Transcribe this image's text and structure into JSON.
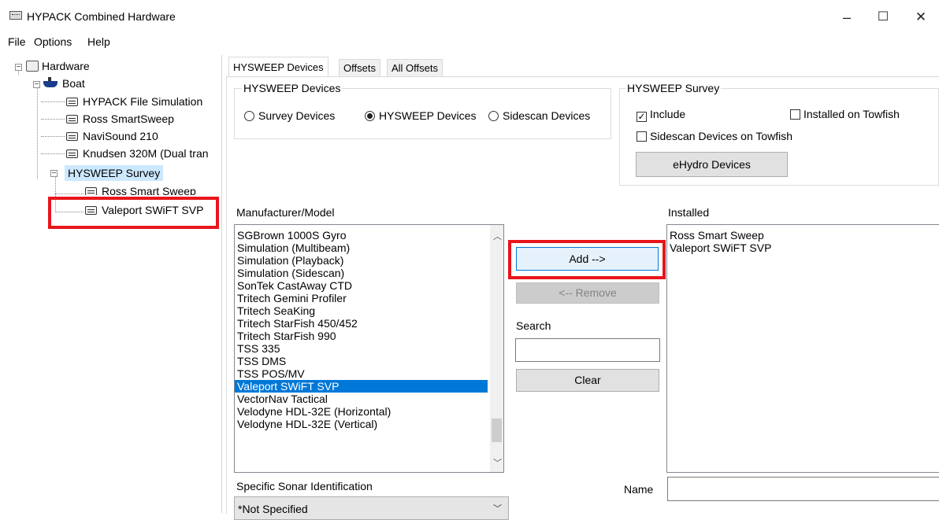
{
  "window": {
    "title": "HYPACK Combined Hardware",
    "minimize": "–",
    "maximize": "☐",
    "close": "✕"
  },
  "menu": [
    "File",
    "Options",
    "Help"
  ],
  "tree": {
    "root": "Hardware",
    "boat": "Boat",
    "boat_items": [
      "HYPACK File Simulation",
      "Ross SmartSweep",
      "NaviSound 210",
      "Knudsen 320M (Dual tran"
    ],
    "hysweep": "HYSWEEP Survey",
    "hysweep_items": [
      "Ross Smart Sweep",
      "Valeport SWiFT SVP"
    ]
  },
  "tabs": [
    "HYSWEEP Devices",
    "Offsets",
    "All Offsets"
  ],
  "devices_group": {
    "legend": "HYSWEEP Devices",
    "radios": [
      "Survey Devices",
      "HYSWEEP Devices",
      "Sidescan Devices"
    ],
    "selected": "HYSWEEP Devices"
  },
  "survey_group": {
    "legend": "HYSWEEP Survey",
    "include": "Include",
    "include_checked": true,
    "installed_towfish": "Installed on Towfish",
    "sidescan_towfish": "Sidescan Devices on Towfish",
    "ehydro": "eHydro Devices"
  },
  "manufacturer": {
    "label": "Manufacturer/Model",
    "items": [
      "SGBrown 1000S Gyro",
      "Simulation (Multibeam)",
      "Simulation (Playback)",
      "Simulation (Sidescan)",
      "SonTek CastAway CTD",
      "Tritech Gemini Profiler",
      "Tritech SeaKing",
      "Tritech StarFish 450/452",
      "Tritech StarFish 990",
      "TSS 335",
      "TSS DMS",
      "TSS POS/MV",
      "Valeport SWiFT SVP",
      "VectorNav Tactical",
      "Velodyne HDL-32E (Horizontal)",
      "Velodyne HDL-32E (Vertical)"
    ],
    "selected_index": 12
  },
  "buttons": {
    "add": "Add -->",
    "remove": "<-- Remove",
    "clear": "Clear"
  },
  "search": {
    "label": "Search",
    "value": ""
  },
  "installed": {
    "label": "Installed",
    "items": [
      "Ross Smart Sweep",
      "Valeport SWiFT SVP"
    ]
  },
  "sonar_id": {
    "label": "Specific Sonar Identification",
    "value": "*Not Specified"
  },
  "name": {
    "label": "Name",
    "value": ""
  },
  "accent": {
    "selection": "#0078d7",
    "highlight": "#e8151b"
  }
}
